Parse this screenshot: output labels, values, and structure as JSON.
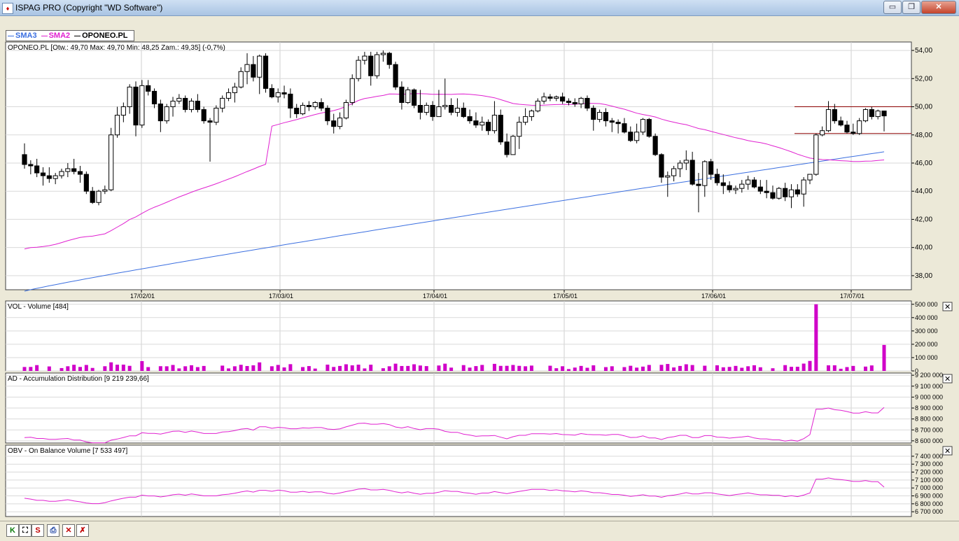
{
  "window": {
    "title": "ISPAG PRO (Copyright \"WD Software\")",
    "minimize_glyph": "▭",
    "maximize_glyph": "❐",
    "close_glyph": "✕"
  },
  "legend": [
    {
      "label": "SMA3",
      "color": "#3b6fe0"
    },
    {
      "label": "SMA2",
      "color": "#e020d0"
    },
    {
      "label": "OPONEO.PL",
      "color": "#000000"
    }
  ],
  "panels": {
    "price": {
      "header": "OPONEO.PL [Otw.: 49,70  Max: 49,70  Min: 48,25  Zam.: 49,35] (-0,7%)",
      "y_ticks": [
        "54,00",
        "52,00",
        "50,00",
        "48,00",
        "46,00",
        "44,00",
        "42,00",
        "40,00",
        "38,00"
      ],
      "x_ticks": [
        "17/02/01",
        "17/03/01",
        "17/04/01",
        "17/05/01",
        "17/06/01",
        "17/07/01"
      ]
    },
    "vol": {
      "header": "VOL - Volume [484]",
      "y_ticks": [
        "500 000",
        "400 000",
        "300 000",
        "200 000",
        "100 000",
        "0"
      ]
    },
    "ad": {
      "header": "AD - Accumulation Distribution [9 219 239,66]",
      "y_ticks": [
        "9 200 000",
        "9 100 000",
        "9 000 000",
        "8 900 000",
        "8 800 000",
        "8 700 000",
        "8 600 000"
      ]
    },
    "obv": {
      "header": "OBV - On Balance Volume [7 533 497]",
      "y_ticks": [
        "7 400 000",
        "7 300 000",
        "7 200 000",
        "7 100 000",
        "7 000 000",
        "6 900 000",
        "6 800 000",
        "6 700 000"
      ]
    }
  },
  "panel_close_glyph": "✕",
  "toolbar": [
    {
      "glyph": "K",
      "color": "#0a7a0a",
      "name": "k-button"
    },
    {
      "glyph": "⛶",
      "color": "#000000",
      "name": "fullscreen-icon-button"
    },
    {
      "glyph": "S",
      "color": "#c00000",
      "name": "s-button"
    },
    {
      "glyph": "⎙",
      "color": "#1a3fa0",
      "name": "print-icon-button"
    },
    {
      "glyph": "✕",
      "color": "#c00000",
      "name": "delete-icon-button"
    },
    {
      "glyph": "✗",
      "color": "#c00000",
      "name": "delete-all-icon-button"
    }
  ],
  "chart_data": {
    "type": "candlestick",
    "x_dates": [
      "17/02/01",
      "17/03/01",
      "17/04/01",
      "17/05/01",
      "17/06/01",
      "17/07/01"
    ],
    "candles": [
      [
        46.6,
        47.4,
        45.6,
        45.9
      ],
      [
        45.9,
        46.2,
        45.2,
        45.8
      ],
      [
        45.8,
        46.3,
        45.0,
        45.3
      ],
      [
        45.3,
        45.7,
        44.4,
        45.1
      ],
      [
        45.1,
        45.7,
        44.6,
        44.9
      ],
      [
        44.9,
        45.3,
        44.5,
        45.1
      ],
      [
        45.1,
        45.6,
        44.9,
        45.4
      ],
      [
        45.4,
        46.0,
        45.0,
        45.6
      ],
      [
        45.6,
        46.3,
        45.2,
        45.4
      ],
      [
        45.4,
        45.8,
        44.6,
        45.2
      ],
      [
        45.2,
        45.4,
        43.8,
        44.0
      ],
      [
        44.0,
        44.3,
        43.1,
        43.2
      ],
      [
        43.2,
        44.1,
        43.0,
        44.0
      ],
      [
        44.0,
        44.4,
        43.8,
        44.1
      ],
      [
        44.1,
        48.5,
        44.0,
        48.0
      ],
      [
        48.0,
        50.0,
        47.8,
        49.4
      ],
      [
        49.4,
        50.3,
        48.9,
        50.0
      ],
      [
        50.0,
        51.6,
        49.5,
        51.4
      ],
      [
        51.4,
        51.8,
        47.9,
        48.7
      ],
      [
        48.7,
        51.9,
        48.5,
        51.5
      ],
      [
        51.5,
        51.9,
        50.8,
        51.1
      ],
      [
        51.1,
        51.3,
        49.9,
        50.2
      ],
      [
        50.2,
        50.5,
        48.2,
        49.0
      ],
      [
        49.0,
        50.2,
        48.8,
        50.0
      ],
      [
        50.0,
        50.7,
        49.3,
        50.4
      ],
      [
        50.4,
        50.9,
        50.2,
        50.6
      ],
      [
        50.6,
        50.8,
        49.6,
        49.8
      ],
      [
        49.8,
        50.6,
        49.6,
        50.4
      ],
      [
        50.4,
        50.9,
        49.6,
        49.8
      ],
      [
        49.8,
        50.0,
        48.8,
        49.0
      ],
      [
        49.0,
        49.2,
        46.1,
        48.9
      ],
      [
        48.9,
        50.1,
        48.7,
        49.9
      ],
      [
        49.9,
        50.8,
        49.6,
        50.6
      ],
      [
        50.6,
        51.3,
        50.4,
        51.0
      ],
      [
        51.0,
        51.7,
        50.3,
        51.4
      ],
      [
        51.4,
        52.8,
        51.3,
        52.5
      ],
      [
        52.5,
        53.8,
        51.6,
        53.0
      ],
      [
        53.0,
        53.6,
        51.8,
        52.1
      ],
      [
        52.1,
        53.7,
        50.9,
        53.6
      ],
      [
        53.6,
        53.8,
        51.0,
        51.3
      ],
      [
        51.3,
        51.6,
        50.6,
        50.7
      ],
      [
        50.7,
        51.3,
        50.3,
        51.0
      ],
      [
        51.0,
        51.5,
        50.6,
        50.9
      ],
      [
        50.9,
        51.3,
        49.2,
        49.9
      ],
      [
        49.9,
        50.2,
        49.2,
        49.5
      ],
      [
        49.5,
        50.3,
        49.4,
        50.1
      ],
      [
        50.1,
        50.4,
        49.7,
        50.0
      ],
      [
        50.0,
        50.4,
        49.8,
        50.3
      ],
      [
        50.3,
        50.6,
        49.7,
        49.9
      ],
      [
        49.9,
        50.1,
        48.7,
        49.0
      ],
      [
        49.0,
        49.5,
        48.1,
        48.6
      ],
      [
        48.6,
        49.6,
        48.4,
        49.2
      ],
      [
        49.2,
        50.5,
        49.1,
        50.3
      ],
      [
        50.3,
        52.3,
        50.1,
        52.0
      ],
      [
        52.0,
        53.6,
        51.8,
        53.3
      ],
      [
        53.3,
        53.9,
        53.0,
        53.6
      ],
      [
        53.6,
        53.9,
        51.5,
        52.2
      ],
      [
        52.2,
        53.9,
        52.0,
        53.7
      ],
      [
        53.7,
        54.0,
        53.2,
        53.8
      ],
      [
        53.8,
        53.9,
        52.7,
        53.0
      ],
      [
        53.0,
        53.2,
        51.2,
        51.4
      ],
      [
        51.4,
        51.8,
        49.8,
        50.3
      ],
      [
        50.3,
        51.4,
        50.2,
        51.2
      ],
      [
        51.2,
        51.3,
        49.9,
        50.1
      ],
      [
        50.1,
        51.2,
        49.1,
        49.6
      ],
      [
        49.6,
        50.3,
        49.4,
        50.1
      ],
      [
        50.1,
        50.4,
        49.0,
        49.3
      ],
      [
        49.3,
        51.2,
        49.3,
        50.0
      ],
      [
        50.0,
        52.0,
        49.8,
        50.1
      ],
      [
        50.1,
        50.6,
        49.4,
        49.6
      ],
      [
        49.6,
        50.6,
        49.3,
        49.9
      ],
      [
        49.9,
        50.3,
        49.2,
        49.3
      ],
      [
        49.3,
        49.8,
        48.8,
        49.0
      ],
      [
        49.0,
        49.6,
        48.5,
        48.7
      ],
      [
        48.7,
        49.3,
        48.3,
        48.9
      ],
      [
        48.9,
        49.1,
        48.0,
        48.3
      ],
      [
        48.3,
        50.4,
        48.1,
        49.4
      ],
      [
        49.4,
        49.8,
        47.3,
        47.5
      ],
      [
        47.5,
        48.1,
        46.4,
        46.6
      ],
      [
        46.6,
        48.0,
        46.6,
        47.9
      ],
      [
        47.9,
        49.3,
        47.0,
        48.9
      ],
      [
        48.9,
        49.9,
        48.7,
        49.3
      ],
      [
        49.3,
        49.8,
        49.0,
        49.7
      ],
      [
        49.7,
        50.6,
        49.6,
        50.4
      ],
      [
        50.4,
        51.0,
        50.2,
        50.7
      ],
      [
        50.7,
        50.9,
        50.4,
        50.6
      ],
      [
        50.6,
        50.8,
        50.4,
        50.7
      ],
      [
        50.7,
        51.0,
        50.2,
        50.4
      ],
      [
        50.4,
        50.6,
        50.1,
        50.3
      ],
      [
        50.3,
        50.6,
        50.0,
        50.2
      ],
      [
        50.2,
        50.7,
        49.9,
        50.6
      ],
      [
        50.6,
        50.8,
        49.7,
        49.9
      ],
      [
        49.9,
        50.1,
        48.3,
        49.1
      ],
      [
        49.1,
        49.8,
        48.9,
        49.6
      ],
      [
        49.6,
        49.9,
        48.6,
        49.0
      ],
      [
        49.0,
        49.2,
        48.2,
        48.9
      ],
      [
        48.9,
        49.1,
        48.1,
        48.8
      ],
      [
        48.8,
        49.2,
        48.1,
        48.2
      ],
      [
        48.2,
        48.6,
        47.5,
        47.6
      ],
      [
        47.6,
        48.8,
        47.4,
        48.2
      ],
      [
        48.2,
        49.2,
        48.0,
        49.1
      ],
      [
        49.1,
        49.2,
        47.8,
        47.9
      ],
      [
        47.9,
        48.1,
        46.5,
        46.6
      ],
      [
        46.6,
        46.7,
        44.6,
        45.0
      ],
      [
        45.0,
        45.4,
        43.6,
        45.1
      ],
      [
        45.1,
        45.8,
        44.7,
        45.6
      ],
      [
        45.6,
        46.2,
        45.0,
        46.0
      ],
      [
        46.0,
        46.9,
        45.5,
        46.2
      ],
      [
        46.2,
        46.8,
        44.4,
        44.5
      ],
      [
        44.5,
        45.3,
        42.5,
        44.4
      ],
      [
        44.4,
        46.2,
        43.6,
        46.1
      ],
      [
        46.1,
        46.3,
        44.8,
        45.2
      ],
      [
        45.2,
        45.6,
        44.4,
        44.6
      ],
      [
        44.6,
        45.2,
        43.8,
        44.4
      ],
      [
        44.4,
        44.7,
        43.9,
        44.1
      ],
      [
        44.1,
        44.4,
        43.8,
        44.2
      ],
      [
        44.2,
        44.8,
        43.9,
        44.5
      ],
      [
        44.5,
        45.1,
        44.1,
        44.8
      ],
      [
        44.8,
        45.0,
        44.2,
        44.3
      ],
      [
        44.3,
        44.8,
        43.8,
        44.0
      ],
      [
        44.0,
        44.8,
        43.5,
        43.9
      ],
      [
        43.9,
        44.4,
        43.4,
        43.5
      ],
      [
        43.5,
        44.3,
        43.4,
        44.2
      ],
      [
        44.2,
        44.6,
        43.3,
        43.6
      ],
      [
        43.6,
        44.5,
        42.8,
        44.1
      ],
      [
        44.1,
        44.5,
        43.6,
        43.8
      ],
      [
        43.8,
        45.0,
        42.9,
        44.8
      ],
      [
        44.8,
        45.2,
        44.5,
        45.2
      ],
      [
        45.2,
        48.1,
        45.1,
        48.0
      ],
      [
        48.0,
        48.6,
        47.9,
        48.3
      ],
      [
        48.3,
        50.4,
        48.2,
        49.8
      ],
      [
        49.8,
        50.2,
        48.8,
        49.0
      ],
      [
        49.0,
        49.3,
        48.6,
        48.7
      ],
      [
        48.7,
        49.0,
        48.1,
        48.2
      ],
      [
        48.2,
        48.8,
        48.0,
        48.1
      ],
      [
        48.1,
        49.2,
        48.0,
        49.0
      ],
      [
        49.0,
        49.9,
        48.9,
        49.8
      ],
      [
        49.8,
        50.0,
        49.1,
        49.3
      ],
      [
        49.3,
        49.8,
        49.1,
        49.7
      ],
      [
        49.7,
        49.7,
        48.25,
        49.35
      ]
    ],
    "sma_long_start_end": [
      36.9,
      46.8
    ],
    "horizontal_lines": [
      50.0,
      48.1
    ],
    "volume_peak": 500000,
    "ad_range": [
      8580000,
      9220000
    ],
    "obv_range": [
      6640000,
      7540000
    ]
  }
}
